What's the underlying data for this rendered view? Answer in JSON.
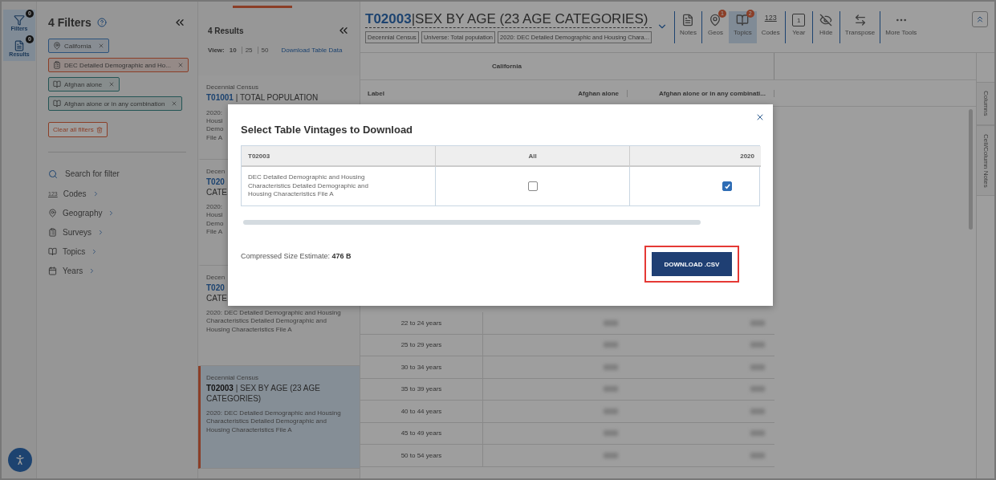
{
  "rail": [
    {
      "label": "Filters",
      "badge": "0",
      "kind": "filters",
      "selected": true
    },
    {
      "label": "Results",
      "badge": "0",
      "kind": "results",
      "selected": true
    }
  ],
  "filters_panel": {
    "title": "4 Filters",
    "chips": [
      {
        "label": "California",
        "kind": "geo"
      },
      {
        "label": "DEC Detailed Demographic and Ho...",
        "kind": "survey"
      },
      {
        "label": "Afghan alone",
        "kind": "topic"
      },
      {
        "label": "Afghan alone or in any combination",
        "kind": "topic"
      }
    ],
    "clear_button": "Clear all filters",
    "search_placeholder": "Search for filter",
    "nav": [
      {
        "label": "Codes",
        "kind": "codes",
        "icon_text": "123"
      },
      {
        "label": "Geography",
        "kind": "geography"
      },
      {
        "label": "Surveys",
        "kind": "surveys"
      },
      {
        "label": "Topics",
        "kind": "topics"
      },
      {
        "label": "Years",
        "kind": "years"
      }
    ]
  },
  "results_panel": {
    "title": "4 Results",
    "view_label": "View:",
    "view_options": [
      {
        "label": "10",
        "selected": true
      },
      {
        "label": "25",
        "selected": false
      },
      {
        "label": "50",
        "selected": false
      }
    ],
    "download_link": "Download Table Data",
    "cards": [
      {
        "kind": "clipped",
        "kicker": "Decennial Census",
        "code": "T01001",
        "title": "| TOTAL POPULATION",
        "title_wrapped": false,
        "lines": [
          "2020:",
          "Housi",
          "Demo",
          "File A"
        ],
        "selected": false
      },
      {
        "kind": "clipped",
        "kicker": "Decen",
        "code": "T020",
        "title": "CATE",
        "title_wrapped": true,
        "lines": [
          "2020:",
          "Housi",
          "Demo",
          "File A"
        ],
        "selected": false
      },
      {
        "kind": "full",
        "kicker": "Decen",
        "code": "T020",
        "title": "CATE",
        "title_wrapped": true,
        "description": "2020: DEC Detailed Demographic and Housing Characteristics Detailed Demographic and Housing Characteristics File A",
        "selected": false
      },
      {
        "kind": "full",
        "kicker": "Decennial Census",
        "code": "T02003",
        "title": "| SEX BY AGE (23 AGE CATEGORIES)",
        "title_wrapped": false,
        "description": "2020: DEC Detailed Demographic and Housing Characteristics Detailed Demographic and Housing Characteristics File A",
        "selected": true
      }
    ]
  },
  "table_header": {
    "code": "T02003",
    "title": "|SEX BY AGE (23 AGE CATEGORIES)",
    "tags": [
      "Decennial Census",
      "Universe: Total population",
      "2020: DEC Detailed Demographic and Housing Chara..."
    ]
  },
  "tools": [
    {
      "label": "Notes",
      "kind": "notes",
      "divider": true,
      "selected": false
    },
    {
      "label": "Geos",
      "kind": "geos",
      "badge": "1",
      "divider": true,
      "selected": false
    },
    {
      "label": "Topics",
      "kind": "topics",
      "badge": "2",
      "divider": false,
      "selected": true
    },
    {
      "label": "Codes",
      "kind": "codes",
      "icon_text": "123",
      "divider": false,
      "selected": false
    },
    {
      "label": "Year",
      "kind": "year",
      "icon_text": "1",
      "divider": true,
      "selected": false
    },
    {
      "label": "Hide",
      "kind": "hide",
      "divider": true,
      "selected": false
    },
    {
      "label": "Transpose",
      "kind": "transpose",
      "divider": true,
      "selected": false
    },
    {
      "label": "More Tools",
      "kind": "more",
      "divider": true,
      "selected": false
    }
  ],
  "table": {
    "geo": "California",
    "label_heading": "Label",
    "columns": [
      "Afghan alone",
      "Afghan alone or in any combinati..."
    ],
    "rows": [
      "22 to 24 years",
      "25 to 29 years",
      "30 to 34 years",
      "35 to 39 years",
      "40 to 44 years",
      "45 to 49 years",
      "50 to 54 years"
    ]
  },
  "side_tabs": [
    "Columns",
    "Cell/Column Notes"
  ],
  "modal": {
    "title": "Select Table Vintages to Download",
    "columns": [
      "T02003",
      "All",
      "2020"
    ],
    "row_label": "DEC Detailed Demographic and Housing Characteristics Detailed Demographic and Housing Characteristics File A",
    "checks": [
      {
        "checked": false
      },
      {
        "checked": true
      }
    ],
    "size_text": "Compressed Size Estimate: **476 B**",
    "button": "DOWNLOAD .CSV",
    "highlighted": true
  }
}
